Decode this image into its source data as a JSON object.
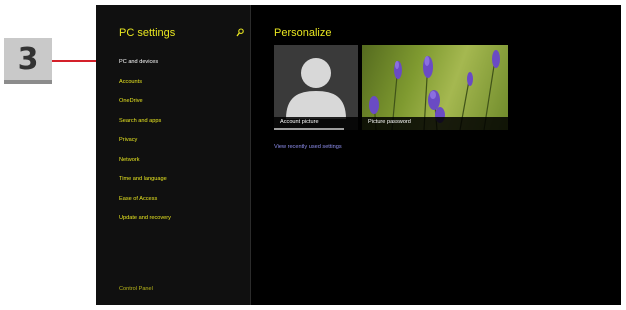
{
  "callout": {
    "step_number": "3"
  },
  "left_pane": {
    "title": "PC settings",
    "nav_items": [
      {
        "label": "PC and devices"
      },
      {
        "label": "Accounts"
      },
      {
        "label": "OneDrive"
      },
      {
        "label": "Search and apps"
      },
      {
        "label": "Privacy"
      },
      {
        "label": "Network"
      },
      {
        "label": "Time and language"
      },
      {
        "label": "Ease of Access"
      },
      {
        "label": "Update and recovery"
      }
    ],
    "control_panel_link": "Control Panel"
  },
  "right_pane": {
    "title": "Personalize",
    "tiles": [
      {
        "caption": "Account picture"
      },
      {
        "caption": "Picture password"
      }
    ],
    "recent_link": "View recently used settings"
  },
  "colors": {
    "accent_text": "#e8e620",
    "link": "#8f8ff0",
    "callout_red": "#e8202a",
    "background": "#000000"
  }
}
